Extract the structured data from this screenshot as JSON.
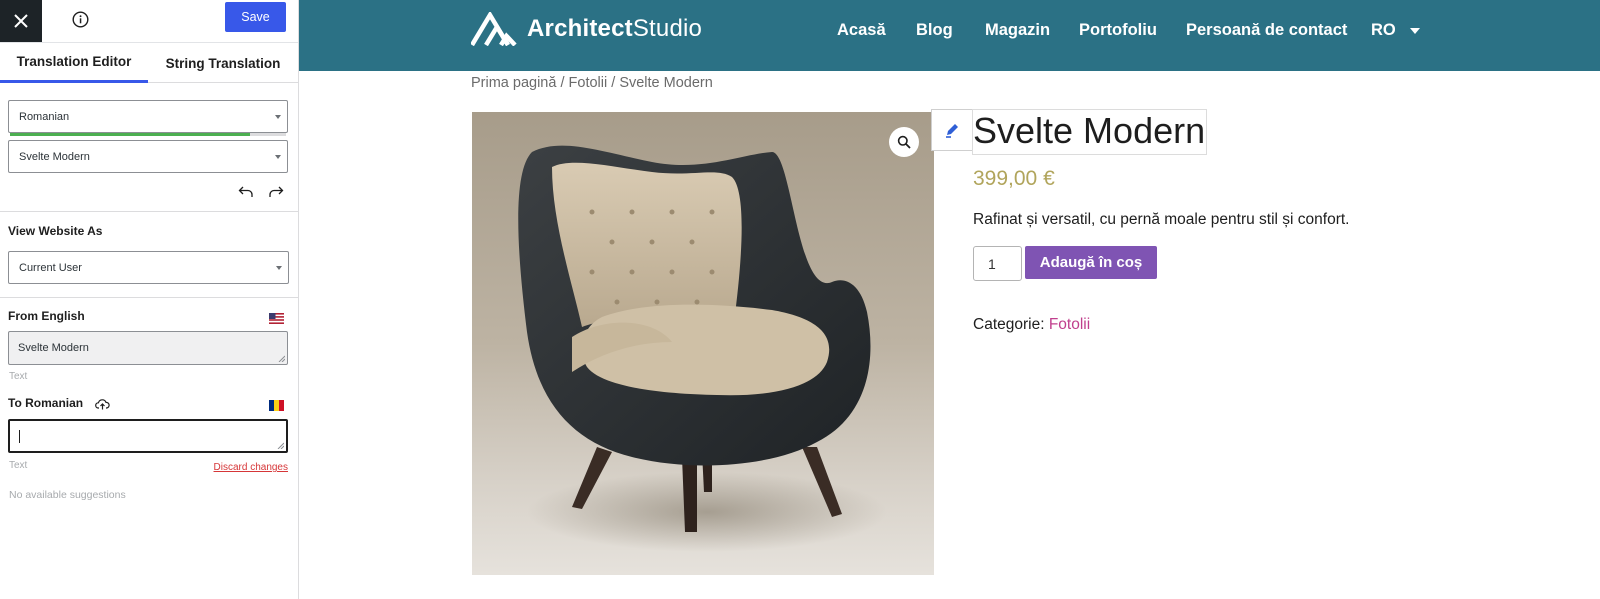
{
  "panel": {
    "save_label": "Save",
    "tabs": [
      {
        "label": "Translation Editor",
        "active": true
      },
      {
        "label": "String Translation",
        "active": false
      }
    ],
    "language_select": {
      "value": "Romanian",
      "progress": 0.87
    },
    "string_select": {
      "value": "Svelte Modern"
    },
    "view_as": {
      "title": "View Website As",
      "value": "Current User"
    },
    "from": {
      "title": "From English",
      "value": "Svelte Modern",
      "type_label": "Text"
    },
    "to": {
      "title": "To Romanian",
      "value": "",
      "type_label": "Text",
      "discard_label": "Discard changes"
    },
    "suggestions": "No available suggestions"
  },
  "site": {
    "logo": {
      "bold": "Architect",
      "light": "Studio"
    },
    "nav": [
      "Acasă",
      "Blog",
      "Magazin",
      "Portofoliu",
      "Persoană de contact"
    ],
    "lang": "RO",
    "breadcrumb": {
      "home": "Prima pagină",
      "sep": " / ",
      "category": "Fotolii",
      "current": "Svelte Modern"
    },
    "product": {
      "title": "Svelte Modern",
      "price": "399,00 €",
      "description": "Rafinat și versatil, cu pernă moale pentru stil și confort.",
      "quantity": "1",
      "add_to_cart": "Adaugă în coș",
      "category_label": "Categorie: ",
      "category": "Fotolii"
    }
  },
  "colors": {
    "header_bg": "#2b7185",
    "save_button": "#3858e9",
    "add_to_cart": "#7f54b3",
    "price": "#b1a55c",
    "category_link": "#c03f8d"
  }
}
